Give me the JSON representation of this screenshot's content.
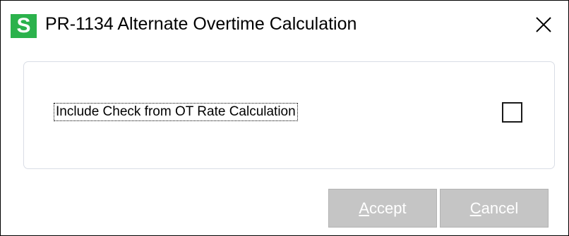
{
  "window": {
    "title": "PR-1134 Alternate Overtime Calculation",
    "app_icon_letter": "S",
    "app_icon_color": "#2bb24c",
    "close_icon": "close-icon"
  },
  "option": {
    "label": "Include Check from OT Rate Calculation",
    "checked": false
  },
  "buttons": {
    "accept": {
      "mnemonic": "A",
      "rest": "ccept"
    },
    "cancel": {
      "mnemonic": "C",
      "rest": "ancel"
    }
  }
}
